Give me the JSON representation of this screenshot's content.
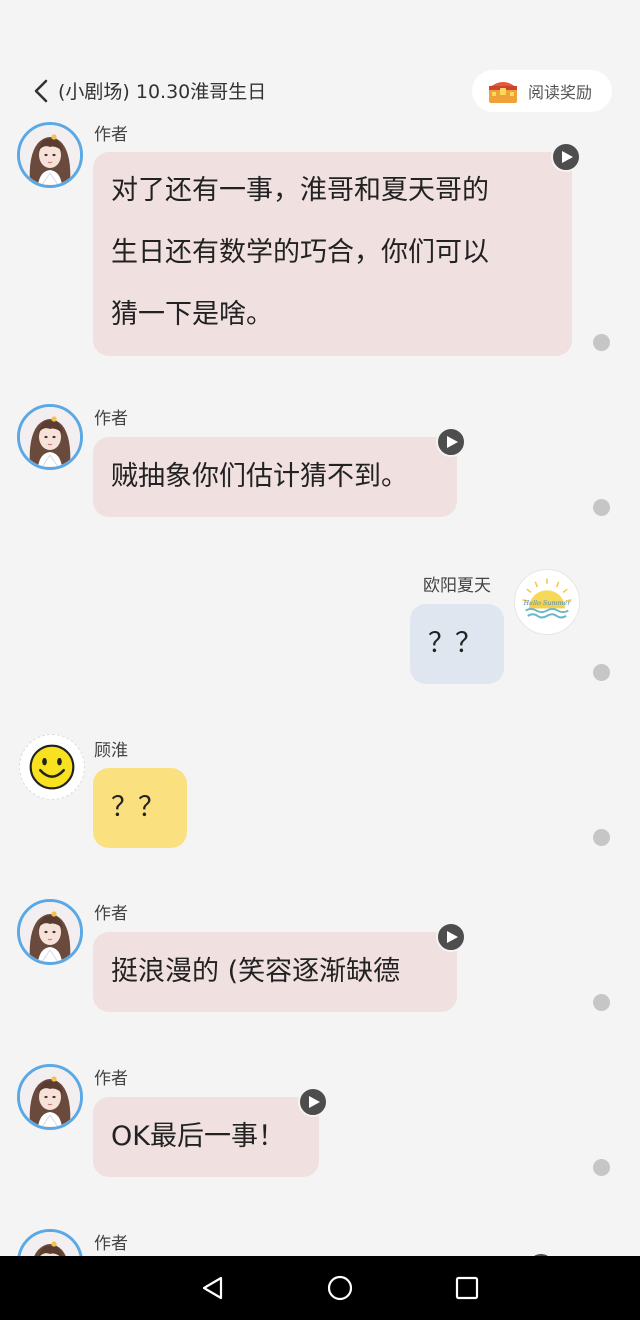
{
  "header": {
    "title": "(小剧场) 10.30淮哥生日",
    "reward_label": "阅读奖励"
  },
  "messages": [
    {
      "sender": "作者",
      "side": "left",
      "avatar": "author-avatar",
      "text_lines": [
        "对了还有一事，淮哥和夏天哥的",
        "生日还有数学的巧合，你们可以",
        "猜一下是啥。"
      ],
      "has_audio": true
    },
    {
      "sender": "作者",
      "side": "left",
      "avatar": "author-avatar",
      "text_lines": [
        "贼抽象你们估计猜不到。"
      ],
      "has_audio": true
    },
    {
      "sender": "欧阳夏天",
      "side": "right",
      "avatar": "hello-summer-avatar",
      "text_lines": [
        "？？"
      ],
      "has_audio": false
    },
    {
      "sender": "顾淮",
      "side": "left",
      "avatar": "smiley-avatar",
      "text_lines": [
        "？？"
      ],
      "has_audio": false
    },
    {
      "sender": "作者",
      "side": "left",
      "avatar": "author-avatar",
      "text_lines": [
        "挺浪漫的 (笑容逐渐缺德"
      ],
      "has_audio": true
    },
    {
      "sender": "作者",
      "side": "left",
      "avatar": "author-avatar",
      "text_lines": [
        "OK最后一事！"
      ],
      "has_audio": true
    },
    {
      "sender": "作者",
      "side": "left",
      "avatar": "author-avatar",
      "text_lines": [],
      "has_audio": true
    }
  ],
  "sun_avatar_text": "Hello Summer",
  "navbar": {
    "icons": [
      "back-triangle-icon",
      "home-circle-icon",
      "recents-square-icon"
    ]
  },
  "colors": {
    "background": "#f4f4f4",
    "author_bubble": "#f0e0e0",
    "summer_bubble": "#dfe6ef",
    "guhuai_bubble": "#fbe07f",
    "avatar_ring": "#5aa9e6"
  }
}
